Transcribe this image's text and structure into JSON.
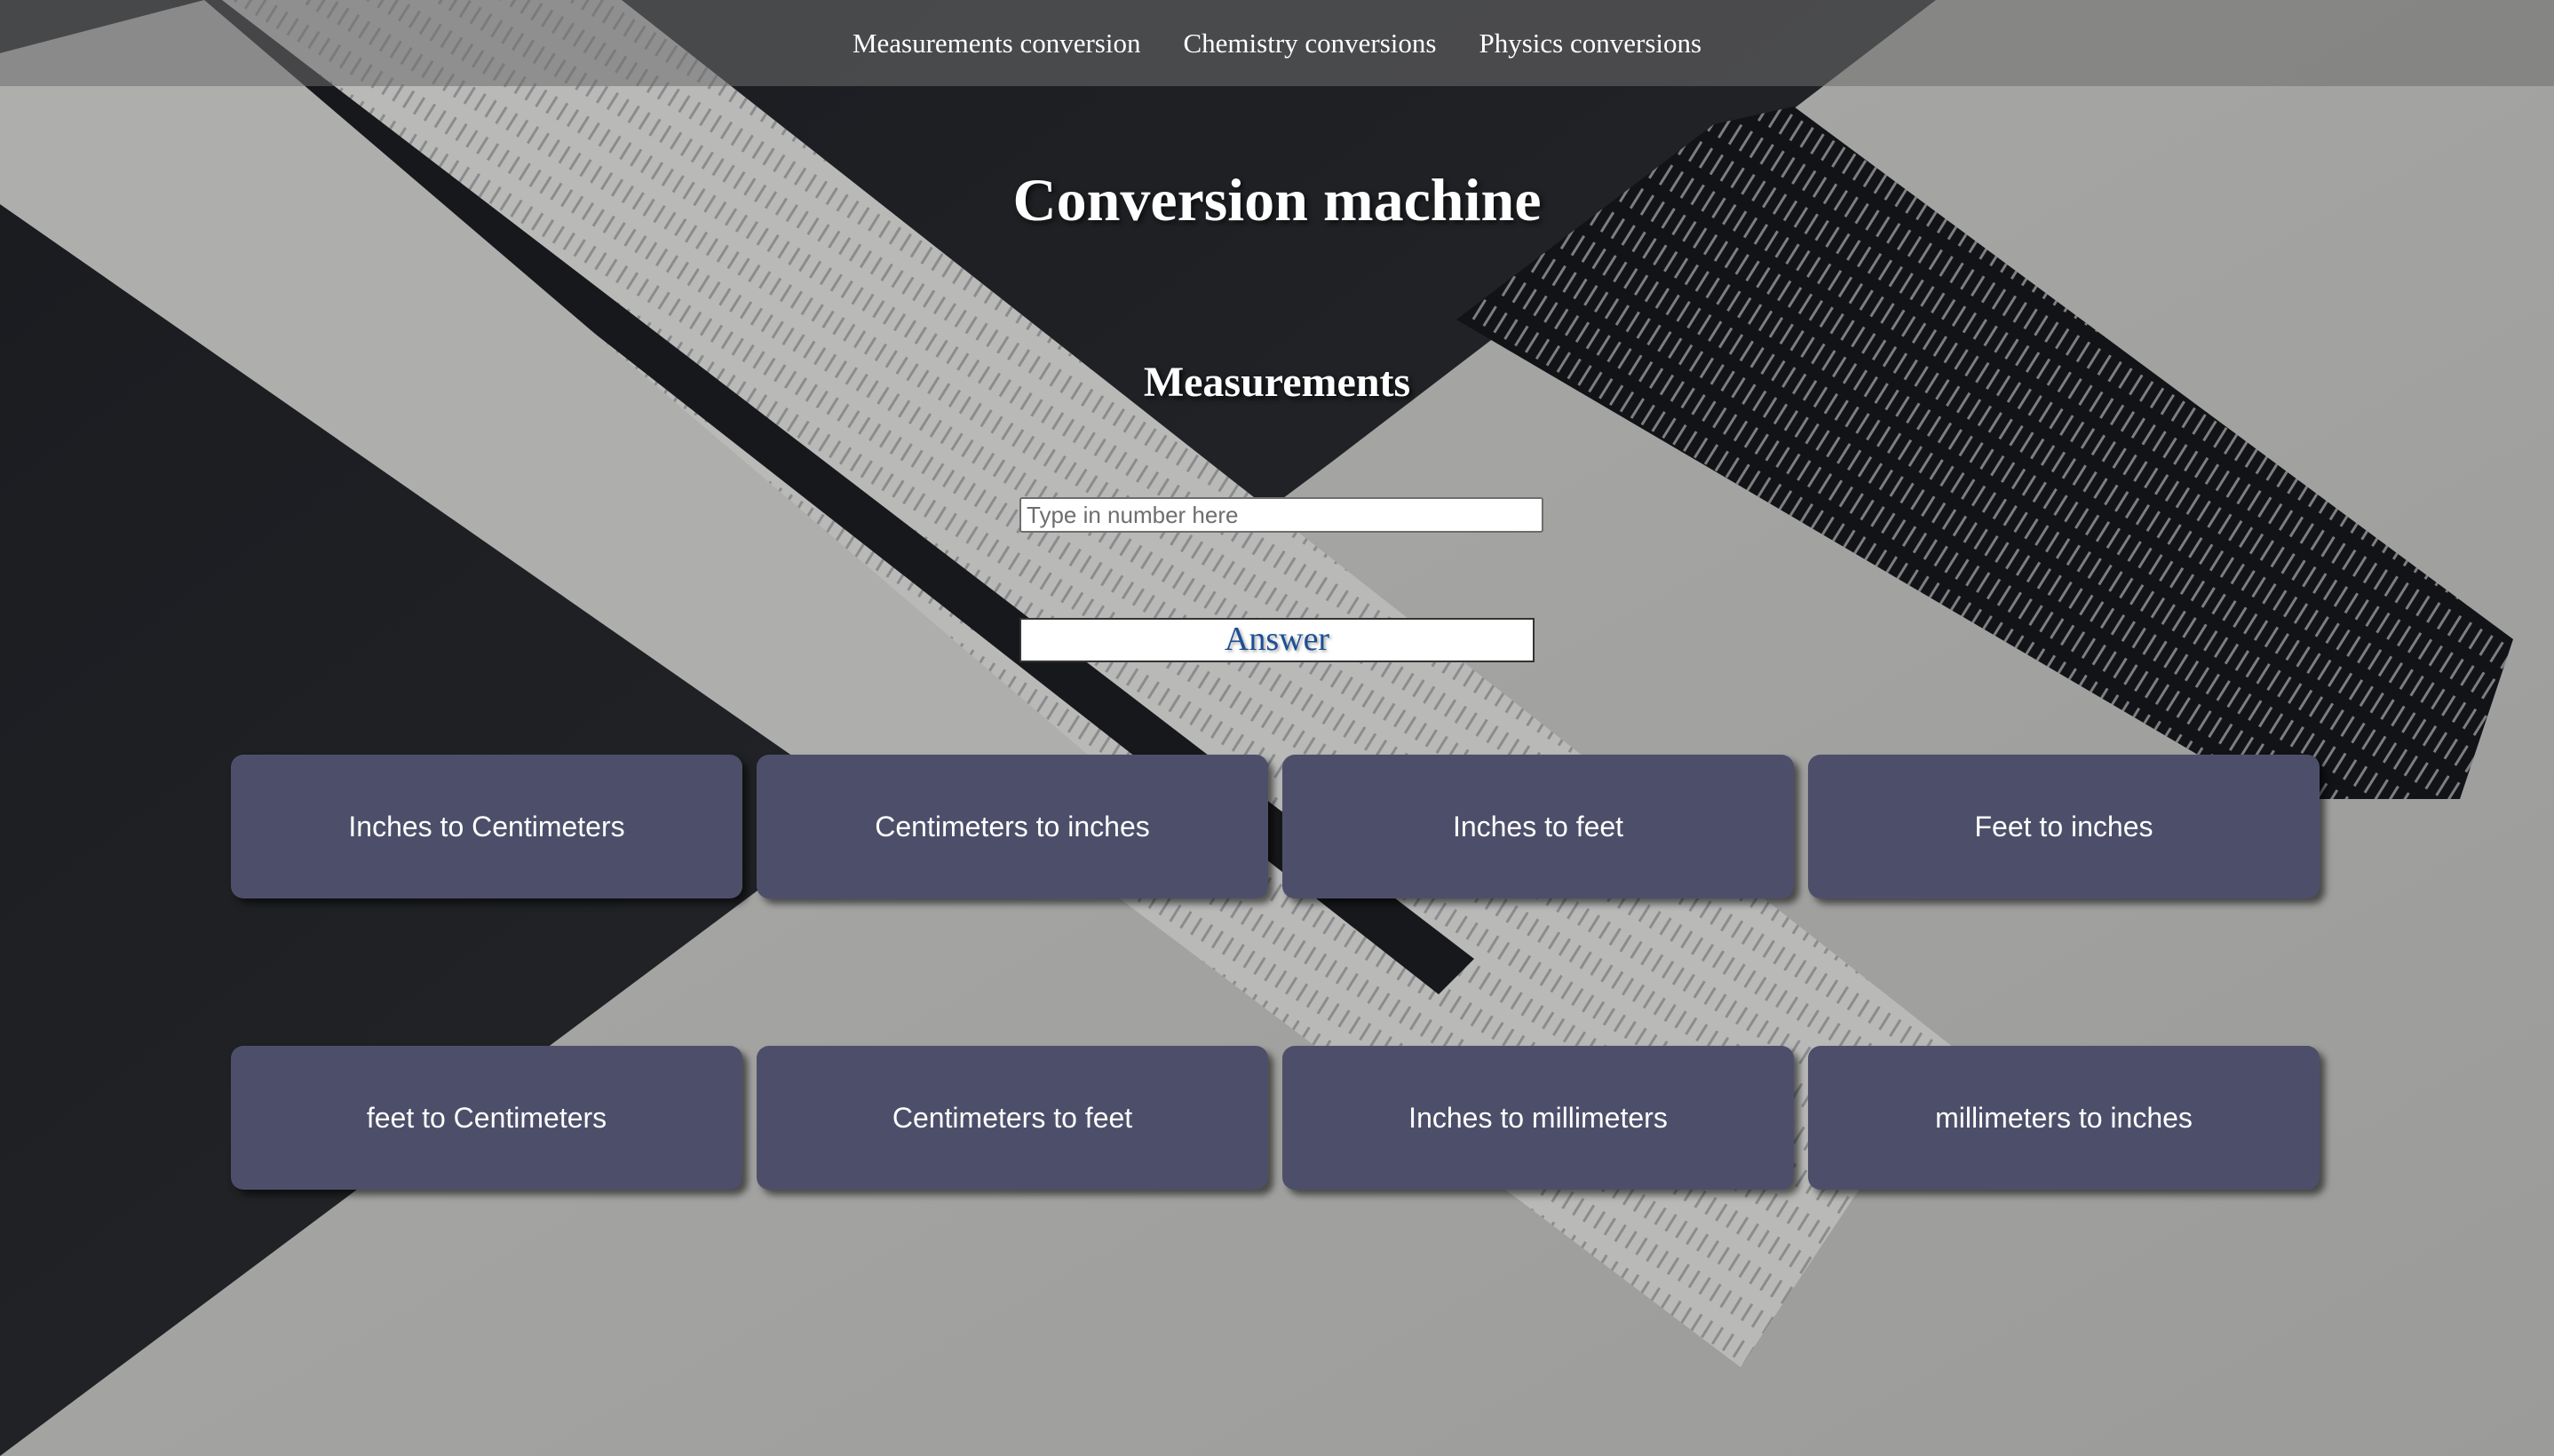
{
  "nav": {
    "items": [
      "Measurements conversion",
      "Chemistry conversions",
      "Physics conversions"
    ]
  },
  "page": {
    "title": "Conversion machine",
    "section_title": "Measurements"
  },
  "input": {
    "placeholder": "Type in number here",
    "value": ""
  },
  "answer": {
    "text": "Answer"
  },
  "buttons": [
    "Inches to Centimeters",
    "Centimeters to inches",
    "Inches to feet",
    "Feet to inches",
    "feet to Centimeters",
    "Centimeters to feet",
    "Inches to millimeters",
    "millimeters to inches"
  ],
  "colors": {
    "button_bg": "#4d4f6a",
    "answer_text": "#1d4f94",
    "nav_bg": "rgba(110,110,110,0.55)"
  }
}
